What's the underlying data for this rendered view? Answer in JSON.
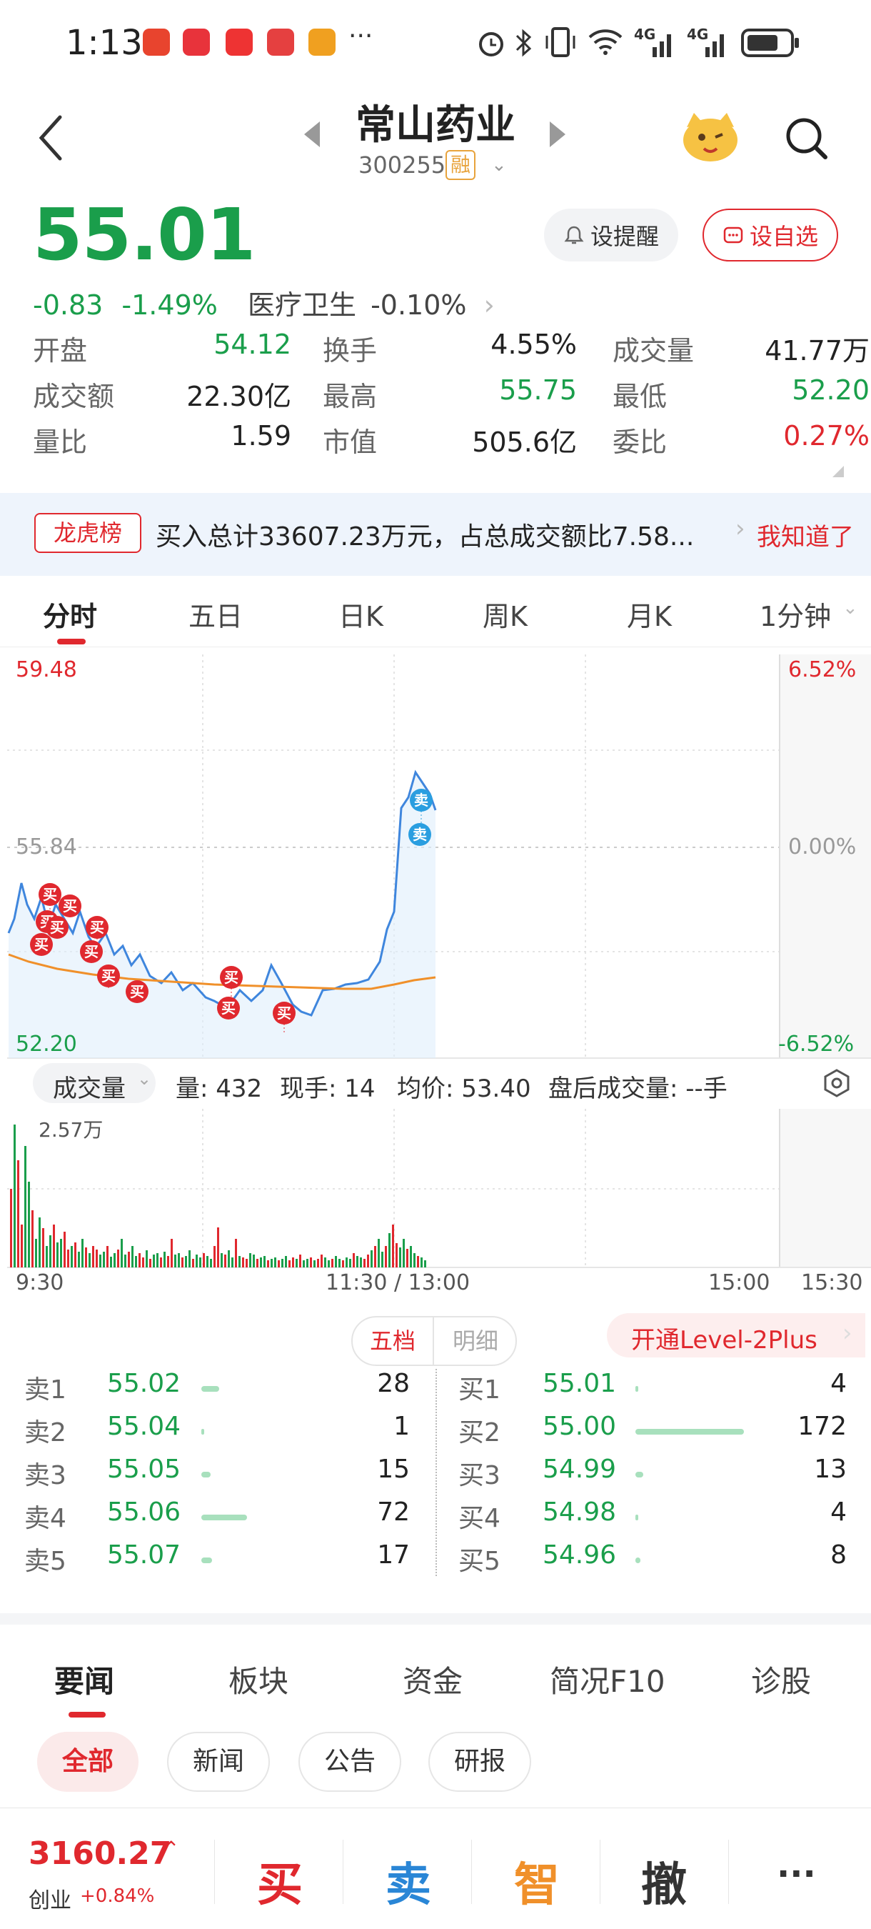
{
  "status_bar": {
    "time": "1:13",
    "dots": "···",
    "net1": "4G",
    "net2": "4G"
  },
  "header": {
    "name": "常山药业",
    "code": "300255",
    "badge": "融"
  },
  "quote": {
    "price": "55.01",
    "change": "-0.83",
    "change_pct": "-1.49%",
    "sector": "医疗卫生",
    "sector_pct": "-0.10%",
    "remind_label": "设提醒",
    "fav_label": "设自选"
  },
  "stats": [
    [
      {
        "k": "开盘",
        "v": "54.12",
        "c": "green"
      },
      {
        "k": "换手",
        "v": "4.55%",
        "c": "dark"
      },
      {
        "k": "成交量",
        "v": "41.77万",
        "c": "dark"
      }
    ],
    [
      {
        "k": "成交额",
        "v": "22.30亿",
        "c": "dark"
      },
      {
        "k": "最高",
        "v": "55.75",
        "c": "green"
      },
      {
        "k": "最低",
        "v": "52.20",
        "c": "green"
      }
    ],
    [
      {
        "k": "量比",
        "v": "1.59",
        "c": "dark"
      },
      {
        "k": "市值",
        "v": "505.6亿",
        "c": "dark"
      },
      {
        "k": "委比",
        "v": "0.27%",
        "c": "red"
      }
    ]
  ],
  "banner": {
    "tag": "龙虎榜",
    "text": "买入总计33607.23万元，占总成交额比7.58...",
    "action": "我知道了"
  },
  "tabs": [
    "分时",
    "五日",
    "日K",
    "周K",
    "月K",
    "1分钟"
  ],
  "chart": {
    "y_top": "59.48",
    "y_mid": "55.84",
    "y_bot": "52.20",
    "pct_top": "6.52%",
    "pct_mid": "0.00%",
    "pct_bot": "-6.52%",
    "vol_max": "2.57万",
    "t_start": "9:30",
    "t_mid": "11:30 / 13:00",
    "t_3": "15:00",
    "t_end": "15:30",
    "buy": "买",
    "sell": "卖"
  },
  "vol_info": {
    "selector": "成交量",
    "liang": "量: 432",
    "xianshou": "现手: 14",
    "junjia": "均价: 53.40",
    "panhou": "盘后成交量: --手"
  },
  "orderbook": {
    "tab_active": "五档",
    "tab_other": "明细",
    "level2": "开通Level-2Plus",
    "sells": [
      {
        "label": "卖1",
        "price": "55.02",
        "vol": "28"
      },
      {
        "label": "卖2",
        "price": "55.04",
        "vol": "1"
      },
      {
        "label": "卖3",
        "price": "55.05",
        "vol": "15"
      },
      {
        "label": "卖4",
        "price": "55.06",
        "vol": "72"
      },
      {
        "label": "卖5",
        "price": "55.07",
        "vol": "17"
      }
    ],
    "buys": [
      {
        "label": "买1",
        "price": "55.01",
        "vol": "4"
      },
      {
        "label": "买2",
        "price": "55.00",
        "vol": "172"
      },
      {
        "label": "买3",
        "price": "54.99",
        "vol": "13"
      },
      {
        "label": "买4",
        "price": "54.98",
        "vol": "4"
      },
      {
        "label": "买5",
        "price": "54.96",
        "vol": "8"
      }
    ]
  },
  "news_tabs": [
    "要闻",
    "板块",
    "资金",
    "简况F10",
    "诊股"
  ],
  "chips": [
    "全部",
    "新闻",
    "公告",
    "研报"
  ],
  "bottom": {
    "index_value": "3160.27",
    "index_name": "创业",
    "index_pct": "+0.84%",
    "buy": "买",
    "sell": "卖",
    "smart": "智",
    "cancel": "撤",
    "more": "···"
  }
}
